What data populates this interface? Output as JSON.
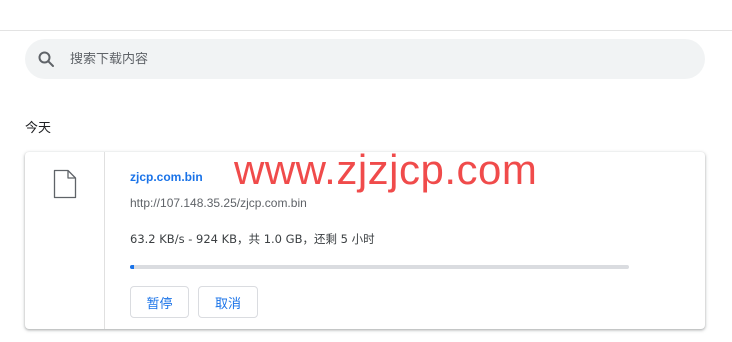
{
  "search": {
    "placeholder": "搜索下载内容",
    "value": ""
  },
  "section": {
    "heading": "今天"
  },
  "downloads": [
    {
      "file_name": "zjcp.com.bin",
      "url": "http://107.148.35.25/zjcp.com.bin",
      "status": "63.2 KB/s - 924 KB，共 1.0 GB，还剩 5 小时",
      "progress": 0.009,
      "pause_label": "暂停",
      "cancel_label": "取消",
      "file_icon": "file-icon"
    }
  ],
  "watermark": {
    "text": "www.zjzjcp.com"
  },
  "colors": {
    "accent": "#1a73e8",
    "watermark": "#f04b4b",
    "search_bg": "#f1f3f4",
    "progress_track": "#dadce0"
  }
}
